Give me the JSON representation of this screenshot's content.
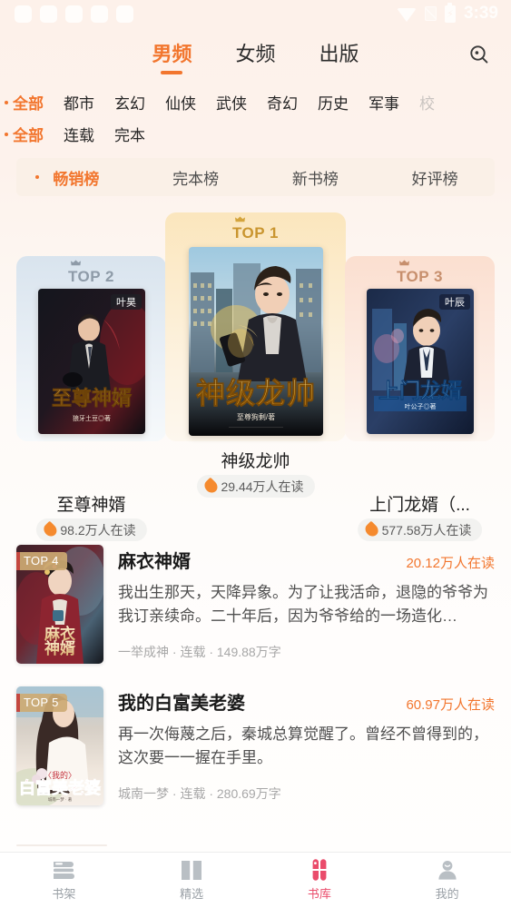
{
  "status_bar": {
    "clock": "3:39",
    "notification_count": 5,
    "icons": [
      "wifi-icon",
      "signal-icon",
      "battery-charging-icon"
    ]
  },
  "header": {
    "tabs": [
      {
        "label": "男频",
        "active": true
      },
      {
        "label": "女频",
        "active": false
      },
      {
        "label": "出版",
        "active": false
      }
    ],
    "search_icon": "search-icon"
  },
  "filters": {
    "genre_row": [
      {
        "label": "全部",
        "active": true
      },
      {
        "label": "都市",
        "active": false
      },
      {
        "label": "玄幻",
        "active": false
      },
      {
        "label": "仙侠",
        "active": false
      },
      {
        "label": "武侠",
        "active": false
      },
      {
        "label": "奇幻",
        "active": false
      },
      {
        "label": "历史",
        "active": false
      },
      {
        "label": "军事",
        "active": false
      },
      {
        "label": "校",
        "active": false,
        "clipped": true
      }
    ],
    "status_row": [
      {
        "label": "全部",
        "active": true
      },
      {
        "label": "连载",
        "active": false
      },
      {
        "label": "完本",
        "active": false
      }
    ]
  },
  "rank_tabs": [
    {
      "label": "畅销榜",
      "active": true
    },
    {
      "label": "完本榜",
      "active": false
    },
    {
      "label": "新书榜",
      "active": false
    },
    {
      "label": "好评榜",
      "active": false
    }
  ],
  "podium": [
    {
      "rank_label": "TOP 2",
      "title": "至尊神婿",
      "hot": "98.2万人在读",
      "cover_author_tag": "叶昊",
      "cover_title": "至尊神婿",
      "cover_byline": "狼牙土豆◎著"
    },
    {
      "rank_label": "TOP 1",
      "title": "神级龙帅",
      "hot": "29.44万人在读",
      "cover_author_tag": "",
      "cover_title": "神级龙帅",
      "cover_byline": "至尊狗剩/著"
    },
    {
      "rank_label": "TOP 3",
      "title": "上门龙婿（...",
      "hot": "577.58万人在读",
      "cover_author_tag": "叶辰",
      "cover_title": "上门龙婿",
      "cover_byline": "叶公子◎著"
    }
  ],
  "book_list": [
    {
      "badge": "TOP 4",
      "title": "麻衣神婿",
      "hot": "20.12万人在读",
      "desc": "我出生那天，天降异象。为了让我活命，退隐的爷爷为我订亲续命。二十年后，因为爷爷给的一场造化…",
      "meta": "一举成神 · 连载 · 149.88万字",
      "cover_title": "麻衣神婿"
    },
    {
      "badge": "TOP 5",
      "title": "我的白富美老婆",
      "hot": "60.97万人在读",
      "desc": "再一次侮蔑之后，秦城总算觉醒了。曾经不曾得到的，这次要一一握在手里。",
      "meta": "城南一梦 · 连载 · 280.69万字",
      "cover_title": "白富美老婆"
    }
  ],
  "bottom_nav": [
    {
      "label": "书架",
      "icon": "bookshelf-icon",
      "active": false
    },
    {
      "label": "精选",
      "icon": "open-book-icon",
      "active": false
    },
    {
      "label": "书库",
      "icon": "clover-library-icon",
      "active": true
    },
    {
      "label": "我的",
      "icon": "user-profile-icon",
      "active": false
    }
  ],
  "colors": {
    "accent_orange": "#f2762e",
    "nav_active_pink": "#ea4c6b",
    "page_bg_top": "#fdf1ea",
    "page_bg_bottom": "#fffefd",
    "rank_bar_bg": "#faf0e7",
    "gold": "#c9952f",
    "silver": "#8e9ba8",
    "bronze": "#c78f6d"
  }
}
